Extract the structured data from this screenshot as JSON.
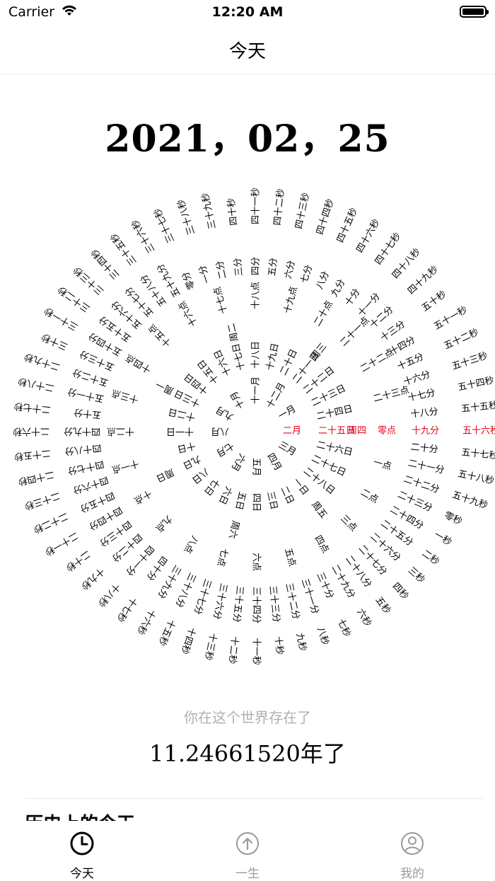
{
  "status_bar": {
    "carrier": "Carrier",
    "time": "12:20 AM"
  },
  "nav": {
    "title": "今天"
  },
  "date_display": "2021，02，25",
  "dial": {
    "months": [
      "一月",
      "二月",
      "三月",
      "四月",
      "五月",
      "六月",
      "七月",
      "八月",
      "九月",
      "十月",
      "十一月",
      "十二月"
    ],
    "days": [
      "一日",
      "二日",
      "三日",
      "四日",
      "五日",
      "六日",
      "七日",
      "八日",
      "九日",
      "十日",
      "十一日",
      "十二日",
      "十三日",
      "十四日",
      "十五日",
      "十六日",
      "十七日",
      "十八日",
      "十九日",
      "二十日",
      "二十一日",
      "二十二日",
      "二十三日",
      "二十四日",
      "二十五日",
      "二十六日",
      "二十七日",
      "二十八日"
    ],
    "weekdays": [
      "周一",
      "周二",
      "周三",
      "周四",
      "周五",
      "周六",
      "周日"
    ],
    "hours": [
      "零点",
      "一点",
      "二点",
      "三点",
      "四点",
      "五点",
      "六点",
      "七点",
      "八点",
      "九点",
      "十点",
      "十一点",
      "十二点",
      "十三点",
      "十四点",
      "十五点",
      "十六点",
      "十七点",
      "十八点",
      "十九点",
      "二十点",
      "二十一点",
      "二十二点",
      "二十三点"
    ],
    "minutes": [
      "零分",
      "一分",
      "二分",
      "三分",
      "四分",
      "五分",
      "六分",
      "七分",
      "八分",
      "九分",
      "十分",
      "十一分",
      "十二分",
      "十三分",
      "十四分",
      "十五分",
      "十六分",
      "十七分",
      "十八分",
      "十九分",
      "二十分",
      "二十一分",
      "二十二分",
      "二十三分",
      "二十四分",
      "二十五分",
      "二十六分",
      "二十七分",
      "二十八分",
      "二十九分",
      "三十分",
      "三十一分",
      "三十二分",
      "三十三分",
      "三十四分",
      "三十五分",
      "三十六分",
      "三十七分",
      "三十八分",
      "三十九分",
      "四十分",
      "四十一分",
      "四十二分",
      "四十三分",
      "四十四分",
      "四十五分",
      "四十六分",
      "四十七分",
      "四十八分",
      "四十九分",
      "五十分",
      "五十一分",
      "五十二分",
      "五十三分",
      "五十四分",
      "五十五分",
      "五十六分",
      "五十七分",
      "五十八分",
      "五十九分"
    ],
    "seconds": [
      "零秒",
      "一秒",
      "二秒",
      "三秒",
      "四秒",
      "五秒",
      "六秒",
      "七秒",
      "八秒",
      "九秒",
      "十秒",
      "十一秒",
      "十二秒",
      "十三秒",
      "十四秒",
      "十五秒",
      "十六秒",
      "十七秒",
      "十八秒",
      "十九秒",
      "二十秒",
      "二十一秒",
      "二十二秒",
      "二十三秒",
      "二十四秒",
      "二十五秒",
      "二十六秒",
      "二十七秒",
      "二十八秒",
      "二十九秒",
      "三十秒",
      "三十一秒",
      "三十二秒",
      "三十三秒",
      "三十四秒",
      "三十五秒",
      "三十六秒",
      "三十七秒",
      "三十八秒",
      "三十九秒",
      "四十秒",
      "四十一秒",
      "四十二秒",
      "四十三秒",
      "四十四秒",
      "四十五秒",
      "四十六秒",
      "四十七秒",
      "四十八秒",
      "四十九秒",
      "五十秒",
      "五十一秒",
      "五十二秒",
      "五十三秒",
      "五十四秒",
      "五十五秒",
      "五十六秒",
      "五十七秒",
      "五十八秒",
      "五十九秒"
    ],
    "current": {
      "month": "二月",
      "day": "二十五日",
      "weekday": "周四",
      "hour": "零点",
      "minute": "十九分",
      "second": "五十六秒"
    },
    "highlight_color": "#e60012"
  },
  "exist_label": "你在这个世界存在了",
  "years_text": "11.24661520年了",
  "history_title": "历史上的今天",
  "tabs": [
    {
      "label": "今天",
      "icon": "clock-icon",
      "active": true
    },
    {
      "label": "一生",
      "icon": "arrow-up-circle-icon",
      "active": false
    },
    {
      "label": "我的",
      "icon": "person-circle-icon",
      "active": false
    }
  ]
}
